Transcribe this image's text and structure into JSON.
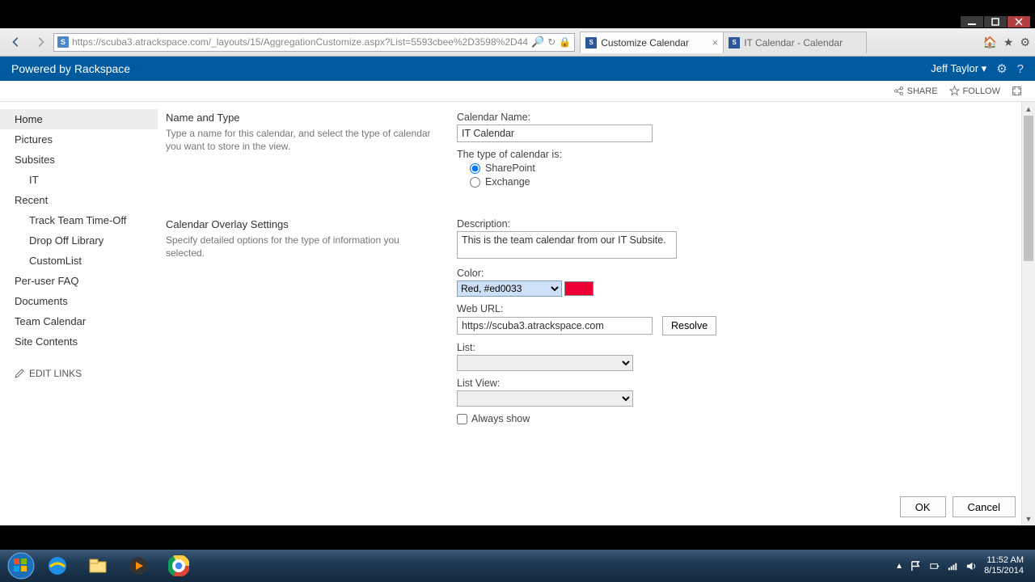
{
  "browser": {
    "url": "https://scuba3.atrackspace.com/_layouts/15/AggregationCustomize.aspx?List=5593cbee%2D3598%2D44",
    "tabs": [
      {
        "title": "Customize Calendar",
        "active": true
      },
      {
        "title": "IT Calendar - Calendar",
        "active": false
      }
    ]
  },
  "header": {
    "brand": "Powered by Rackspace",
    "user": "Jeff Taylor",
    "share": "SHARE",
    "follow": "FOLLOW"
  },
  "quicklaunch": {
    "home": "Home",
    "pictures": "Pictures",
    "subsites": "Subsites",
    "it": "IT",
    "recent": "Recent",
    "track": "Track Team Time-Off",
    "dropoff": "Drop Off Library",
    "customlist": "CustomList",
    "faq": "Per-user FAQ",
    "docs": "Documents",
    "teamcal": "Team Calendar",
    "sitecontents": "Site Contents",
    "edit": "EDIT LINKS"
  },
  "sections": {
    "nameType": {
      "title": "Name and Type",
      "desc": "Type a name for this calendar, and select the type of calendar you want to store in the view."
    },
    "overlay": {
      "title": "Calendar Overlay Settings",
      "desc": "Specify detailed options for the type of information you selected."
    }
  },
  "form": {
    "calendarNameLabel": "Calendar Name:",
    "calendarName": "IT Calendar",
    "typeLabel": "The type of calendar is:",
    "optSharePoint": "SharePoint",
    "optExchange": "Exchange",
    "descriptionLabel": "Description:",
    "description": "This is the team calendar from our IT Subsite.",
    "colorLabel": "Color:",
    "colorOption": "Red, #ed0033",
    "colorHex": "#ed0033",
    "webUrlLabel": "Web URL:",
    "webUrl": "https://scuba3.atrackspace.com",
    "resolve": "Resolve",
    "listLabel": "List:",
    "listViewLabel": "List View:",
    "alwaysShow": "Always show",
    "ok": "OK",
    "cancel": "Cancel"
  },
  "taskbar": {
    "time": "11:52 AM",
    "date": "8/15/2014"
  }
}
